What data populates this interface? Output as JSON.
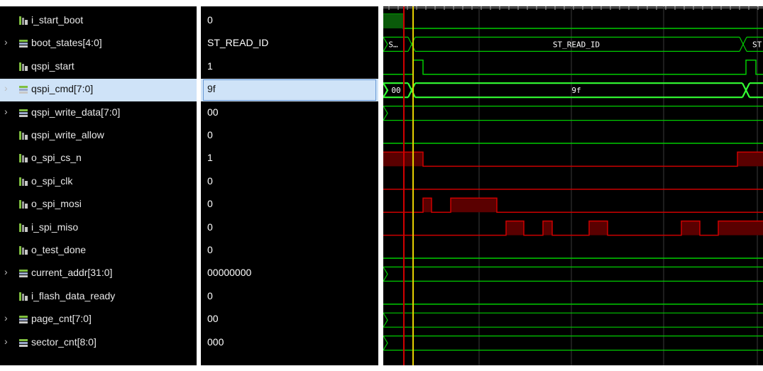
{
  "signals": [
    {
      "id": "i_start_boot",
      "name": "i_start_boot",
      "value": "0",
      "kind": "bit",
      "expandable": false
    },
    {
      "id": "boot_states",
      "name": "boot_states[4:0]",
      "value": "ST_READ_ID",
      "kind": "bus",
      "expandable": true
    },
    {
      "id": "qspi_start",
      "name": "qspi_start",
      "value": "1",
      "kind": "bit",
      "expandable": false
    },
    {
      "id": "qspi_cmd",
      "name": "qspi_cmd[7:0]",
      "value": "9f",
      "kind": "bus",
      "expandable": true,
      "selected": true
    },
    {
      "id": "qspi_write_data",
      "name": "qspi_write_data[7:0]",
      "value": "00",
      "kind": "bus",
      "expandable": true
    },
    {
      "id": "qspi_write_allow",
      "name": "qspi_write_allow",
      "value": "0",
      "kind": "bit",
      "expandable": false
    },
    {
      "id": "o_spi_cs_n",
      "name": "o_spi_cs_n",
      "value": "1",
      "kind": "bit",
      "expandable": false
    },
    {
      "id": "o_spi_clk",
      "name": "o_spi_clk",
      "value": "0",
      "kind": "bit",
      "expandable": false
    },
    {
      "id": "o_spi_mosi",
      "name": "o_spi_mosi",
      "value": "0",
      "kind": "bit",
      "expandable": false
    },
    {
      "id": "i_spi_miso",
      "name": "i_spi_miso",
      "value": "0",
      "kind": "bit",
      "expandable": false
    },
    {
      "id": "o_test_done",
      "name": "o_test_done",
      "value": "0",
      "kind": "bit",
      "expandable": false
    },
    {
      "id": "current_addr",
      "name": "current_addr[31:0]",
      "value": "00000000",
      "kind": "bus",
      "expandable": true
    },
    {
      "id": "i_flash_data_ready",
      "name": "i_flash_data_ready",
      "value": "0",
      "kind": "bit",
      "expandable": false
    },
    {
      "id": "page_cnt",
      "name": "page_cnt[7:0]",
      "value": "00",
      "kind": "bus",
      "expandable": true
    },
    {
      "id": "sector_cnt",
      "name": "sector_cnt[8:0]",
      "value": "000",
      "kind": "bus",
      "expandable": true
    }
  ],
  "waveform_labels": {
    "boot_states_segments": [
      "S…",
      "ST_READ_ID",
      "ST"
    ],
    "qspi_cmd_segments": [
      "00",
      "9f"
    ]
  },
  "colors": {
    "background": "#000000",
    "wave": "#00cc00",
    "highlight_wave": "#33ff33",
    "logic_x": "#cc0000",
    "cursor_red": "#d00000",
    "cursor_yellow": "#e6d000",
    "selection": "#cfe3f8"
  },
  "icons": {
    "expand": "chevron-right-icon",
    "bit_signal": "bit-signal-icon",
    "bus_signal": "bus-signal-icon"
  }
}
